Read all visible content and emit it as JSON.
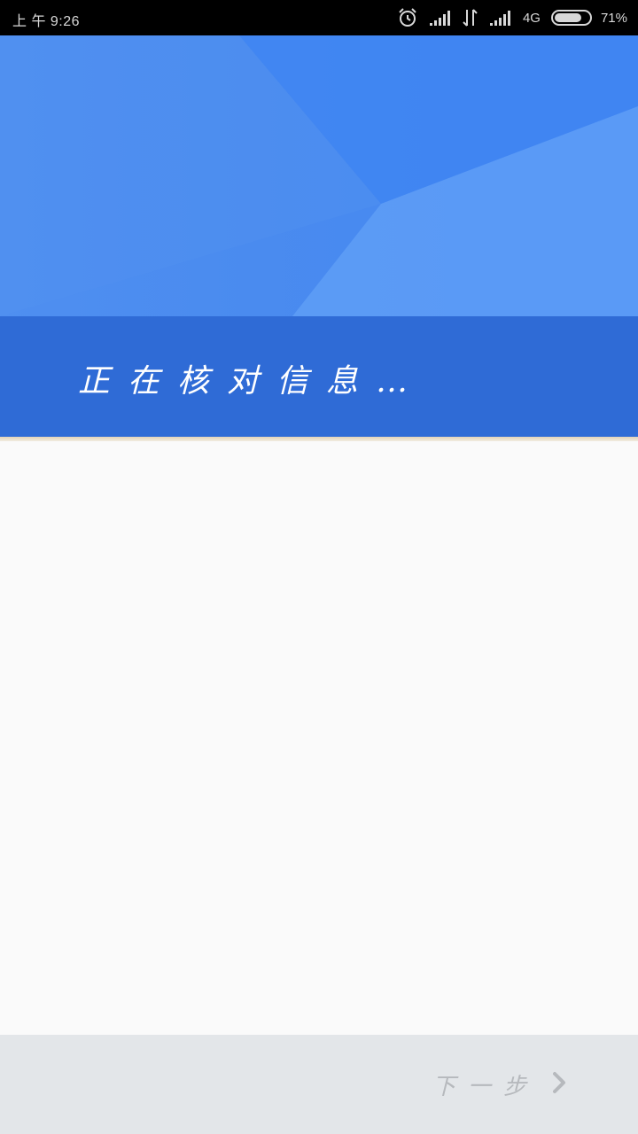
{
  "status_bar": {
    "time": "上 午 9:26",
    "network": "4G",
    "battery_percent": "71%",
    "icons": [
      "alarm-icon",
      "signal-icon",
      "data-transfer-icon",
      "signal-icon",
      "battery-icon"
    ]
  },
  "banner": {
    "message": "正在核对信息…"
  },
  "footer": {
    "next_label": "下一步",
    "next_icon": "chevron-right-icon"
  },
  "colors": {
    "hero_blue": "#4a8bef",
    "banner_blue": "#2f6bd6",
    "footer_bg": "#e3e6e9",
    "next_text": "#b6b9bd"
  }
}
